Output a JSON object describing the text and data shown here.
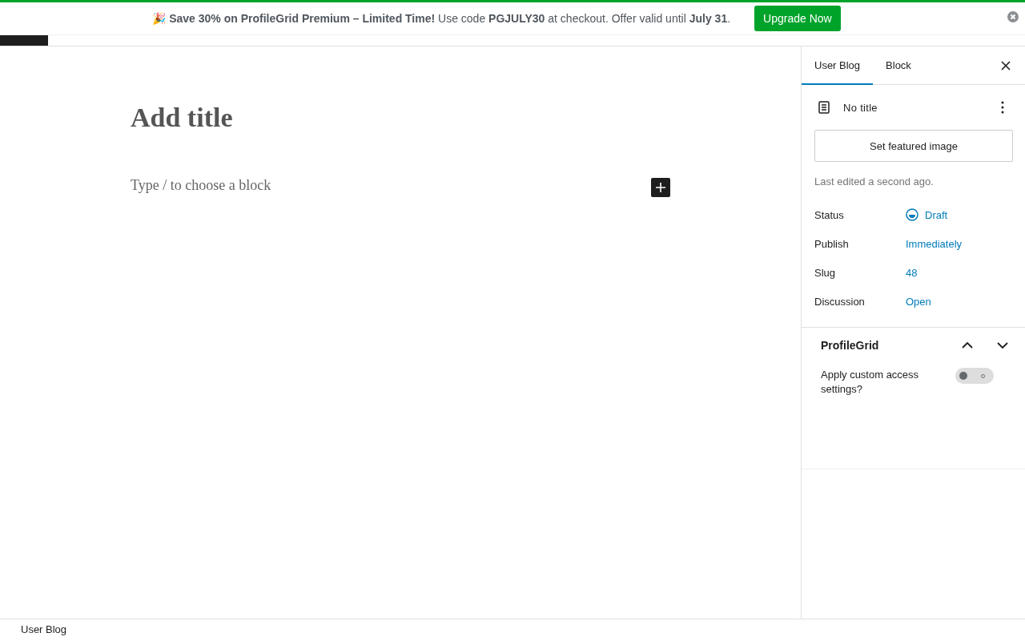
{
  "banner": {
    "message": "🎉 **Save 30% on ProfileGrid Premium – Limited Time!** Use code **PGJULY30** at checkout. Offer valid until **July 31**.",
    "button": "Upgrade Now"
  },
  "editor": {
    "title_placeholder": "Add title",
    "block_placeholder": "Type / to choose a block"
  },
  "sidebar": {
    "tabs": [
      {
        "label": "User Blog",
        "selected": true
      },
      {
        "label": "Block",
        "selected": false
      }
    ],
    "post": {
      "title": "No title",
      "featured_image_button": "Set featured image",
      "last_edited": "Last edited a second ago.",
      "fields": [
        {
          "label": "Status",
          "value": "Draft",
          "kind": "status"
        },
        {
          "label": "Publish",
          "value": "Immediately",
          "kind": "link"
        },
        {
          "label": "Slug",
          "value": "48",
          "kind": "link"
        },
        {
          "label": "Discussion",
          "value": "Open",
          "kind": "link"
        }
      ]
    },
    "panel": {
      "title": "ProfileGrid",
      "expanded": true,
      "option": {
        "label": "Apply custom access settings?",
        "on": false
      }
    }
  },
  "footer": {
    "breadcrumb": "User Blog"
  }
}
